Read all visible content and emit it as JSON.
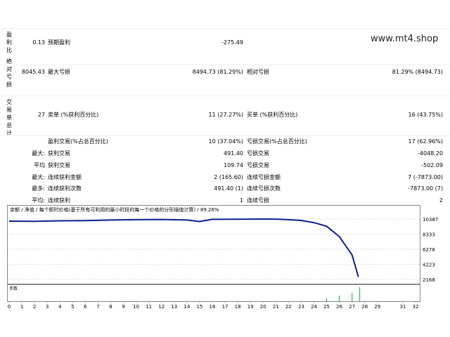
{
  "brand": "www.mt4.shop",
  "side_labels": {
    "profit_factor": "盈利比",
    "absolute_drawdown": "绝对亏损",
    "total_trades": "交易单总计"
  },
  "stats": {
    "row1": {
      "left_value": "0.13",
      "left_label": "预期盈利",
      "mid_value": "-275.49"
    },
    "row2": {
      "left_value": "8045.43",
      "left_label": "最大亏损",
      "mid_value": "8494.73 (81.29%)",
      "right_label": "相对亏损",
      "right_value": "81.29% (8494.73)"
    },
    "row3": {
      "left_value": "27",
      "left_label": "卖单 (%获利百分比)",
      "mid_value": "11 (27.27%)",
      "right_label": "买单 (%获利百分比)",
      "right_value": "16 (43.75%)"
    },
    "row4": {
      "left_label": "盈利交易(%占总百分比)",
      "mid_value": "10 (37.04%)",
      "right_label": "亏损交易(%占总百分比)",
      "right_value": "17 (62.96%)"
    },
    "row5": {
      "prefix": "最大:",
      "left_label": "获利交易",
      "mid_value": "491.40",
      "right_label": "亏损交易",
      "right_value": "-4048.20"
    },
    "row6": {
      "prefix": "平均",
      "left_label": "获利交易",
      "mid_value": "109.74",
      "right_label": "亏损交易",
      "right_value": "-502.09"
    },
    "row7": {
      "prefix": "最大:",
      "left_label": "连续获利金额",
      "mid_value": "2 (165.60)",
      "right_label": "连续亏损金额",
      "right_value": "7 (-7873.00)"
    },
    "row8": {
      "prefix": "最多:",
      "left_label": "连续获利次数",
      "mid_value": "491.40 (1)",
      "right_label": "连续亏损次数",
      "right_value": "-7873.00 (7)"
    },
    "row9": {
      "prefix": "平均:",
      "left_label": "连续获利",
      "mid_value": "1",
      "right_label": "连续亏损",
      "right_value": "2"
    }
  },
  "chart_header": {
    "legend": "余额 / 净值 / 每个即时价格(基于所有可利用的最小时段的每一个价格的分形插值计算) / 89.26%",
    "lots_label": "手数"
  },
  "chart_data": {
    "type": "line",
    "x_ticks": [
      "0",
      "1",
      "2",
      "3",
      "4",
      "5",
      "6",
      "7",
      "8",
      "9",
      "10",
      "11",
      "12",
      "13",
      "14",
      "15",
      "16",
      "17",
      "18",
      "19",
      "20",
      "21",
      "22",
      "23",
      "24",
      "25",
      "26",
      "27",
      "28",
      "29",
      "31",
      "32"
    ],
    "y_ticks": [
      "10387",
      "8333",
      "6278",
      "4223",
      "2168"
    ],
    "ylim": [
      2168,
      10387
    ],
    "series": [
      {
        "points": [
          [
            0,
            10100
          ],
          [
            2,
            10080
          ],
          [
            4,
            10150
          ],
          [
            6,
            10180
          ],
          [
            8,
            10250
          ],
          [
            10,
            10300
          ],
          [
            12,
            10330
          ],
          [
            14,
            10250
          ],
          [
            15,
            10050
          ],
          [
            16,
            10350
          ],
          [
            18,
            10370
          ],
          [
            20,
            10387
          ],
          [
            21,
            10380
          ],
          [
            22,
            10300
          ],
          [
            23,
            10200
          ],
          [
            24,
            9900
          ],
          [
            25,
            9400
          ],
          [
            26,
            8000
          ],
          [
            27,
            5500
          ],
          [
            27.5,
            2500
          ]
        ]
      }
    ],
    "lots_bars": [
      {
        "x": 25,
        "value": 0.2
      },
      {
        "x": 26,
        "value": 0.4
      },
      {
        "x": 27,
        "value": 0.6
      },
      {
        "x": 27.6,
        "value": 1.0
      }
    ],
    "colors": {
      "balance": "#0a1f8f",
      "lots": "#2fb84a",
      "grid": "#c8c8c8"
    }
  }
}
